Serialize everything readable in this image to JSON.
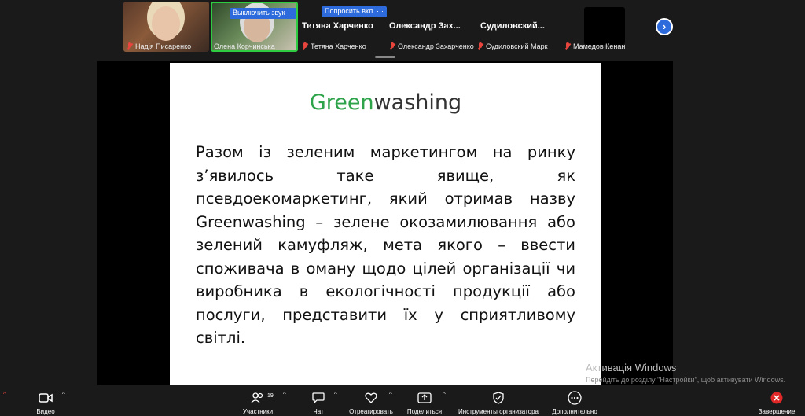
{
  "participants": {
    "tiles": [
      {
        "name": "Надія Писаренко"
      },
      {
        "name": "Олена Корчинська",
        "mute_button": "Выключить звук",
        "more": "···"
      }
    ],
    "named": [
      {
        "big": "Тетяна Харченко",
        "label": "Тетяна Харченко"
      },
      {
        "big": "Олександр  Зах...",
        "label": "Олександр Захарченко"
      },
      {
        "big": "Судиловский...",
        "label": "Судиловский Марк"
      },
      {
        "big": "",
        "label": "Мамедов Кенан"
      }
    ],
    "request_button": "Попросить вкл",
    "request_more": "···",
    "next": "›"
  },
  "slide": {
    "title_green": "Green",
    "title_rest": "washing",
    "body": "Разом із зеленим маркетингом на ринку з’явилось таке явище, як псевдоекомаркетинг, який отримав назву Greenwashing – зелене окозамилювання або зелений камуфляж, мета якого – ввести споживача в оману щодо цілей організації чи виробника в екологічності продукції або послуги, представити їх у сприятливому світлі."
  },
  "windows_activation": {
    "title": "Активація Windows",
    "text": "Перейдіть до розділу \"Настройки\", щоб активувати Windows."
  },
  "toolbar": {
    "video": "Видео",
    "participants": "Участники",
    "participants_count": "19",
    "chat": "Чат",
    "react": "Отреагировать",
    "share": "Поделиться",
    "host_tools": "Инструменты организатора",
    "more": "Дополнительно",
    "end": "Завершение",
    "caret": "^"
  },
  "colors": {
    "accent_blue": "#2d6bdc",
    "active_speaker": "#2ecc40",
    "title_green": "#2ea34a",
    "mic_off": "#e8453c",
    "end_red": "#e02828"
  }
}
